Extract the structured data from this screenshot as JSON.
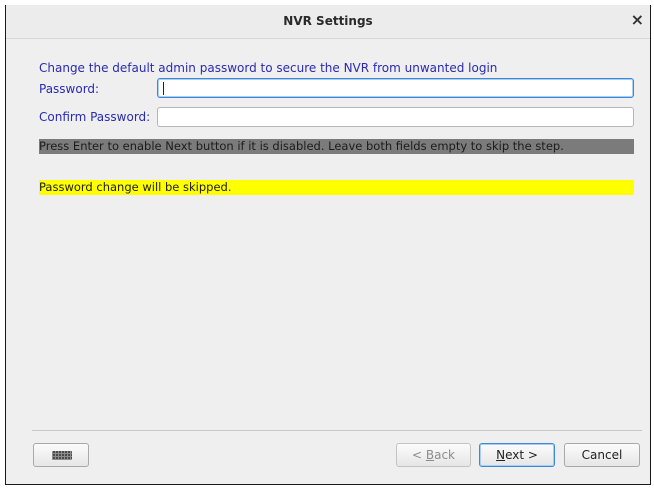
{
  "window": {
    "title": "NVR Settings",
    "close_glyph": "×"
  },
  "form": {
    "heading": "Change the default admin password to secure the NVR from unwanted login",
    "password_label": "Password:",
    "password_value": "",
    "confirm_label": "Confirm Password:",
    "confirm_value": "",
    "hint": "Press Enter to enable Next button if it is disabled. Leave both fields empty to skip the step.",
    "status": "Password change will be skipped."
  },
  "buttons": {
    "keyboard_icon": "keyboard-icon",
    "back_prefix": "< ",
    "back_mnemonic": "B",
    "back_rest": "ack",
    "back_enabled": false,
    "next_mnemonic": "N",
    "next_rest": "ext >",
    "cancel": "Cancel"
  },
  "colors": {
    "label_blue": "#2a2ab0",
    "hint_bg": "#7b7b7b",
    "status_bg": "#ffff00",
    "focus": "#3b8ad9"
  }
}
